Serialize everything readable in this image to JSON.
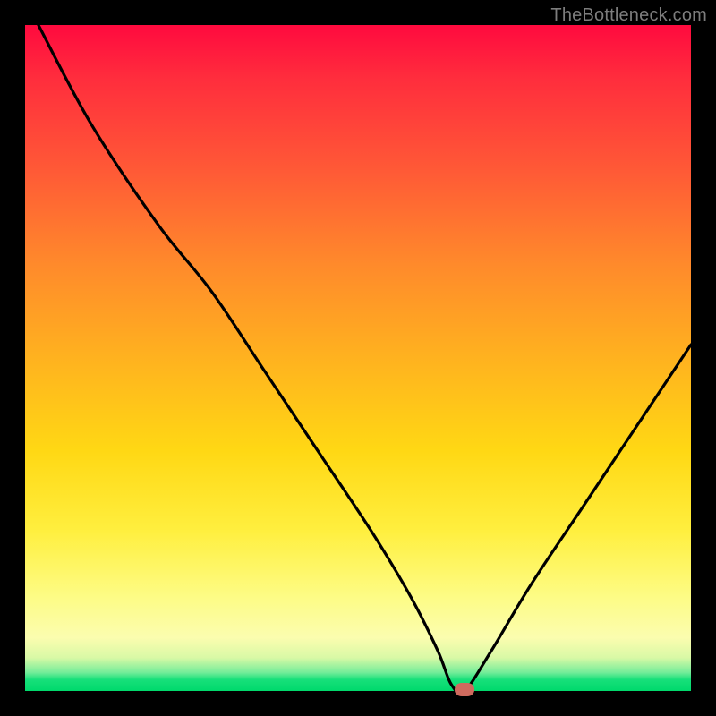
{
  "attribution": "TheBottleneck.com",
  "colors": {
    "frame": "#000000",
    "gradient_top": "#ff0a3e",
    "gradient_mid": "#ffd814",
    "gradient_bottom": "#00d96c",
    "curve": "#000000",
    "marker": "#cf6a5e",
    "attribution_text": "#7d7d7d"
  },
  "chart_data": {
    "type": "line",
    "title": "",
    "xlabel": "",
    "ylabel": "",
    "xlim": [
      0,
      100
    ],
    "ylim": [
      0,
      100
    ],
    "grid": false,
    "legend": false,
    "series": [
      {
        "name": "bottleneck-curve",
        "x": [
          2,
          10,
          20,
          28,
          36,
          44,
          52,
          58,
          62,
          64,
          66,
          70,
          76,
          84,
          92,
          100
        ],
        "y": [
          100,
          85,
          70,
          60,
          48,
          36,
          24,
          14,
          6,
          1,
          0,
          6,
          16,
          28,
          40,
          52
        ]
      }
    ],
    "annotations": [
      {
        "name": "optimal-marker",
        "x": 66,
        "y": 0
      }
    ]
  }
}
